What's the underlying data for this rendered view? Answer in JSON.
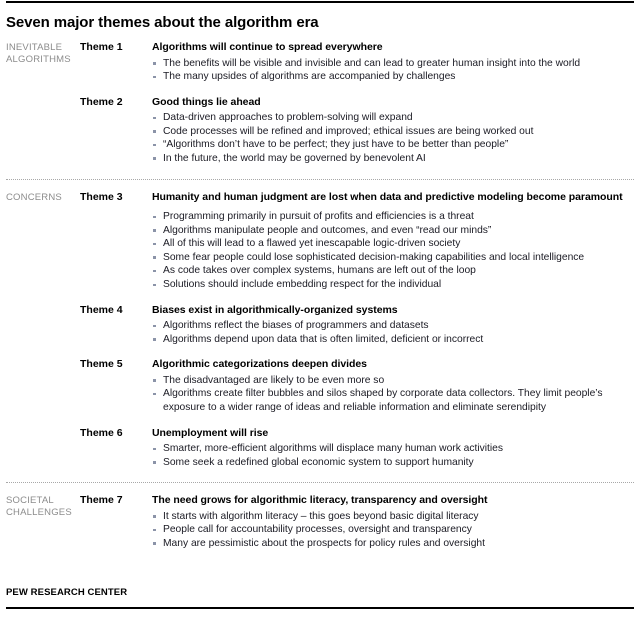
{
  "report": {
    "title": "Seven major themes about the algorithm era",
    "source": "PEW RESEARCH CENTER"
  },
  "sections": [
    {
      "category": "INEVITABLE ALGORITHMS",
      "themes": [
        {
          "label": "Theme 1",
          "heading": "Algorithms will continue to spread everywhere",
          "bullets": [
            "The benefits will be visible and invisible and can lead to greater human insight into the world",
            "The many upsides of algorithms are accompanied by challenges"
          ]
        },
        {
          "label": "Theme 2",
          "heading": "Good things lie ahead",
          "bullets": [
            "Data-driven approaches to problem-solving will expand",
            "Code processes will be refined and improved; ethical issues are being worked out",
            "“Algorithms don’t have to be perfect; they just have to be better than people”",
            "In the future, the world may be governed by benevolent AI"
          ]
        }
      ]
    },
    {
      "category": "CONCERNS",
      "themes": [
        {
          "label": "Theme 3",
          "heading": "Humanity and human judgment are lost when data and predictive modeling become paramount",
          "bullets": [
            "Programming primarily in pursuit of profits and efficiencies is a threat",
            "Algorithms manipulate people and outcomes, and even “read our minds”",
            "All of this will lead to a flawed yet inescapable logic-driven society",
            "Some fear people could lose sophisticated decision-making capabilities and local intelligence",
            "As code takes over complex systems, humans are left out of the loop",
            "Solutions should include embedding respect for the individual"
          ]
        },
        {
          "label": "Theme 4",
          "heading": "Biases exist in algorithmically-organized systems",
          "bullets": [
            "Algorithms reflect the biases of programmers and datasets",
            "Algorithms depend upon data that is often limited, deficient or incorrect"
          ]
        },
        {
          "label": "Theme 5",
          "heading": "Algorithmic categorizations deepen divides",
          "bullets": [
            "The disadvantaged are likely to be even more so",
            "Algorithms create filter bubbles and silos shaped by corporate data collectors. They limit people’s exposure to a wider range of ideas and reliable information and eliminate serendipity"
          ]
        },
        {
          "label": "Theme 6",
          "heading": "Unemployment will rise",
          "bullets": [
            "Smarter, more-efficient algorithms will displace many human work activities",
            "Some seek a redefined global economic system to support humanity"
          ]
        }
      ]
    },
    {
      "category": "SOCIETAL CHALLENGES",
      "themes": [
        {
          "label": "Theme 7",
          "heading": "The need grows for algorithmic literacy, transparency and oversight",
          "bullets": [
            "It starts with algorithm literacy – this goes beyond basic digital literacy",
            "People call for accountability processes, oversight and transparency",
            "Many are pessimistic about the prospects for policy rules and oversight"
          ]
        }
      ]
    }
  ]
}
